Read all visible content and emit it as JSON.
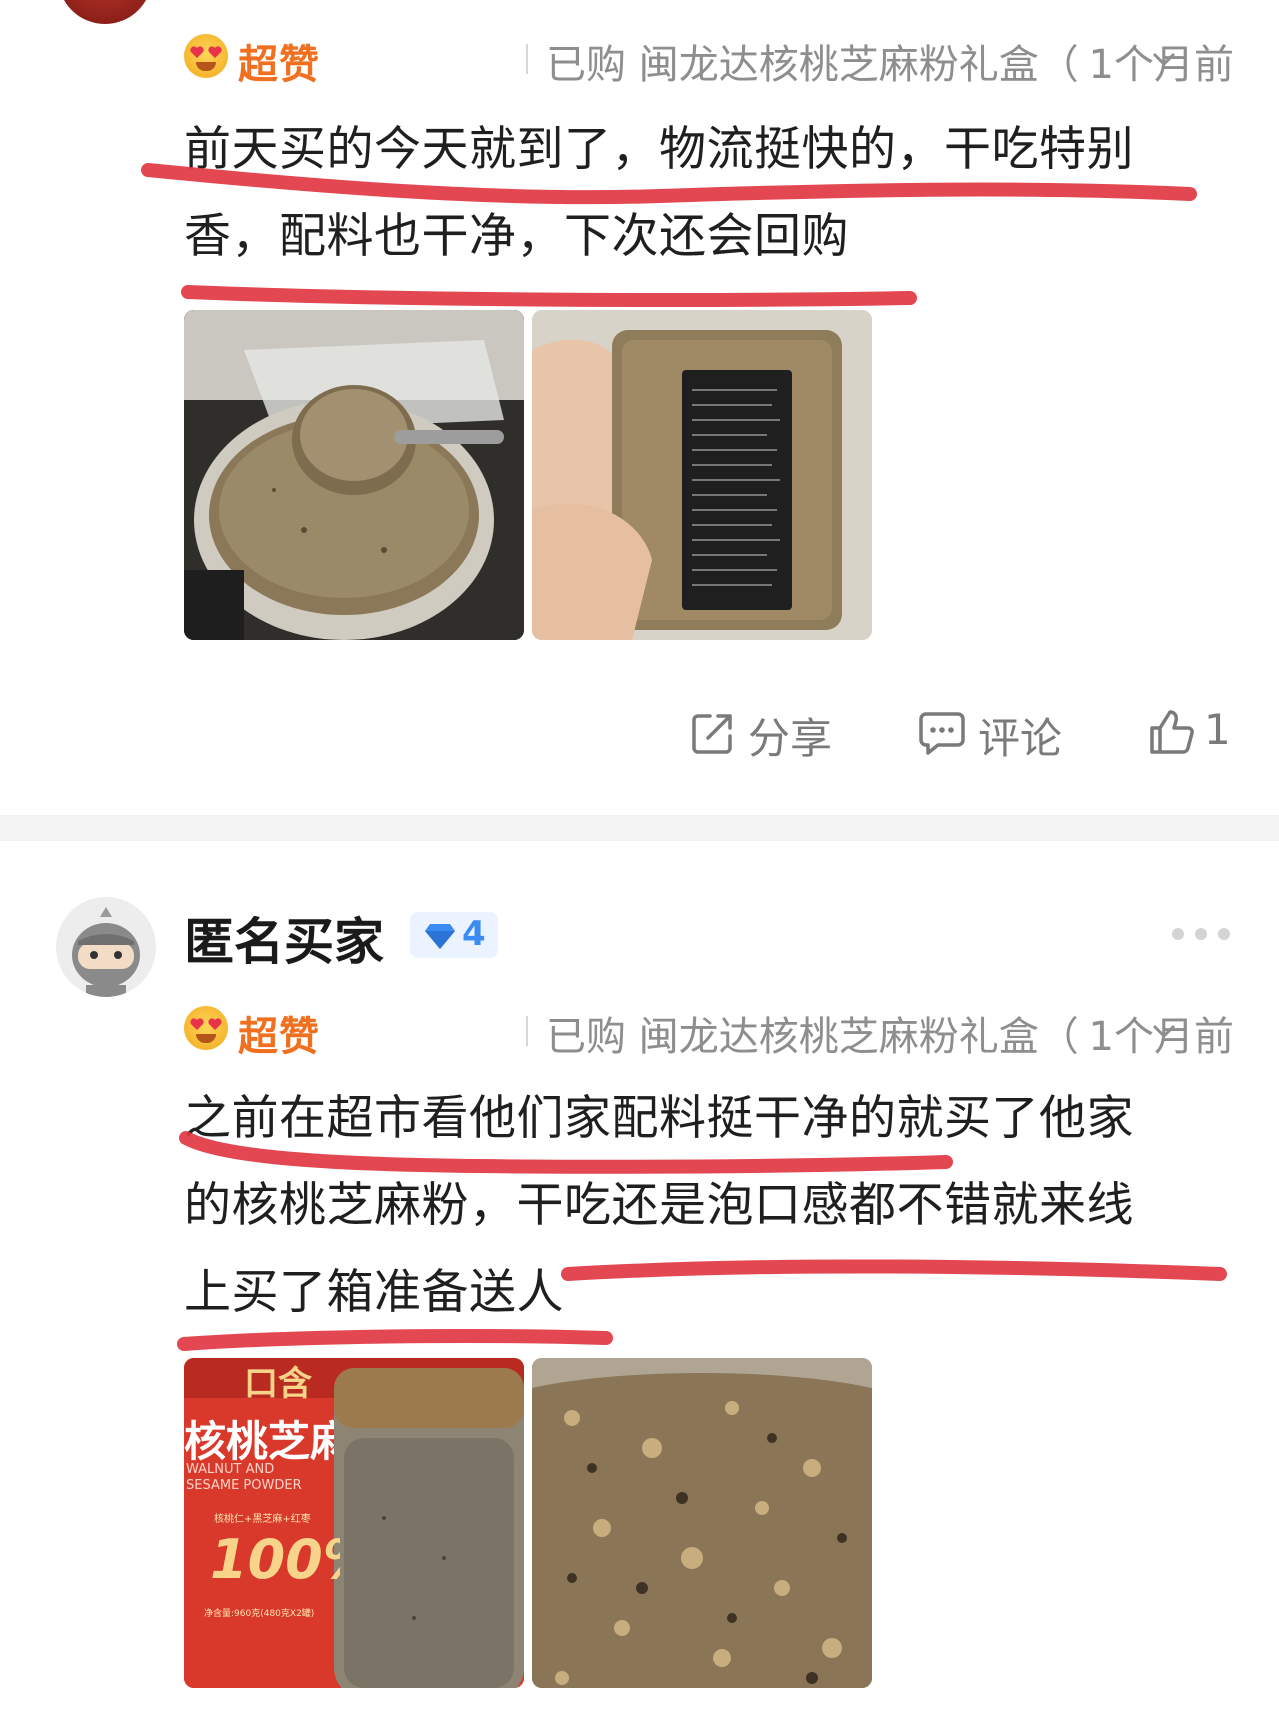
{
  "review1": {
    "badge": "超赞",
    "purchased": "已购 闽龙达核桃芝麻粉礼盒（",
    "time": "1个月前",
    "lines": [
      "前天买的今天就到了，物流挺快的，干吃特别",
      "香，配料也干净，下次还会回购"
    ],
    "actions": {
      "share": "分享",
      "comment": "评论",
      "like_count": "1"
    }
  },
  "review2": {
    "username": "匿名买家",
    "level": "4",
    "badge": "超赞",
    "purchased": "已购 闽龙达核桃芝麻粉礼盒（",
    "time": "1个月前",
    "lines": [
      "之前在超市看他们家配料挺干净的就买了他家",
      "的核桃芝麻粉，干吃还是泡口感都不错就来线",
      "上买了箱准备送人"
    ],
    "product_box": {
      "brand": "口含",
      "title": "核桃芝麻",
      "subtitle_en": "WALNUT AND SESAME POWDER",
      "ingredients": "核桃仁+黑芝麻+红枣",
      "percent": "100%",
      "net_weight": "净含量:960克(480克X2罐)"
    }
  },
  "colors": {
    "accent_orange": "#f0701f",
    "marker_red": "#e0333f",
    "gem_blue": "#3b8cf2",
    "divider": "#f3f3f3"
  }
}
